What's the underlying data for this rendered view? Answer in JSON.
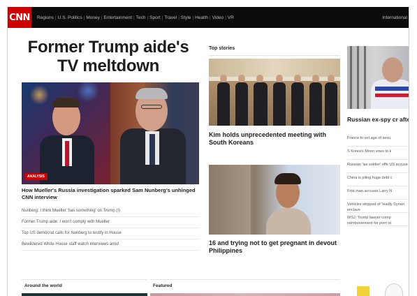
{
  "nav": {
    "logo": "CNN",
    "links": [
      "Regions",
      "U.S. Politics",
      "Money",
      "Entertainment",
      "Tech",
      "Sport",
      "Travel",
      "Style",
      "Health",
      "Video",
      "VR"
    ],
    "right_label": "International"
  },
  "hero": {
    "headline": "Former Trump aide's TV meltdown",
    "badge": "ANALYSIS",
    "story": "How Mueller's Russia investigation sparked Sam Nunberg's unhinged CNN interview",
    "related": [
      "Nunberg: I think Mueller 'has something' on Trump (!)",
      "Former Trump aide: I won't comply with Mueller",
      "Top US democrat calls for Nunberg to testify in House",
      "Bewildered White House staff watch interviews amid"
    ]
  },
  "top_stories": {
    "label": "Top stories",
    "story1": "Kim holds unprecedented meeting with South Koreans",
    "story2": "16 and trying not to get pregnant in devout Philippines"
  },
  "right_column": {
    "headline": "Russian ex-spy cr after 'exposure to",
    "items": [
      "France to set age of sexu",
      "S Korea's Moon vows to k",
      "Russian 'lax soldier' offe US accuse",
      "China is piling huge debt c",
      "First man accuses Larry N",
      "Vehicles stripped of 'leadly Syrian enclave",
      "WSJ: Trump lawyer comp reimbursement for porn st"
    ]
  },
  "bottom": {
    "around_label": "Around the world",
    "featured_label": "Featured"
  },
  "colors": {
    "brand_red": "#cc0000",
    "nav_bg": "#0c0c0c"
  }
}
